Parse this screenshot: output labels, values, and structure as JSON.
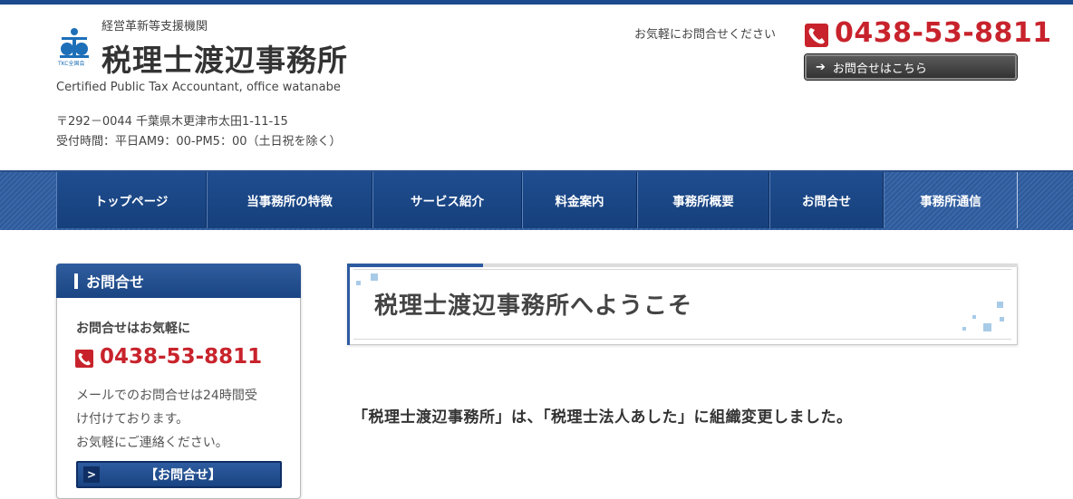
{
  "header": {
    "logo_label": "TKC全国会",
    "tagline": "経営革新等支援機関",
    "title": "税理士渡辺事務所",
    "english": "Certified Public Tax Accountant, office watanabe",
    "address": "〒292－0044 千葉県木更津市太田1-11-15",
    "hours": "受付時間：平日AM9：00-PM5：00（土日祝を除く）",
    "contact_text": "お気軽にお問合せください",
    "phone": "0438-53-8811",
    "contact_button": "お問合せはこちら"
  },
  "nav": {
    "items": [
      {
        "label": "トップページ"
      },
      {
        "label": "当事務所の特徴"
      },
      {
        "label": "サービス紹介"
      },
      {
        "label": "料金案内"
      },
      {
        "label": "事務所概要"
      },
      {
        "label": "お問合せ"
      },
      {
        "label": "事務所通信"
      }
    ]
  },
  "sidebar": {
    "heading": "お問合せ",
    "subheading": "お問合せはお気軽に",
    "phone": "0438-53-8811",
    "desc_line1": "メールでのお問合せは24時間受",
    "desc_line2": "け付けております。",
    "desc_line3": "お気軽にご連絡ください。",
    "button": "【お問合せ】"
  },
  "main": {
    "welcome_title": "税理士渡辺事務所へようこそ",
    "body_text": "「税理士渡辺事務所」は、「税理士法人あした」に組織変更しました。"
  },
  "colors": {
    "brand_blue": "#1d4a8c",
    "phone_red": "#c8232c"
  },
  "icons": [
    "phone-icon",
    "arrow-right-icon",
    "logo-icon"
  ]
}
